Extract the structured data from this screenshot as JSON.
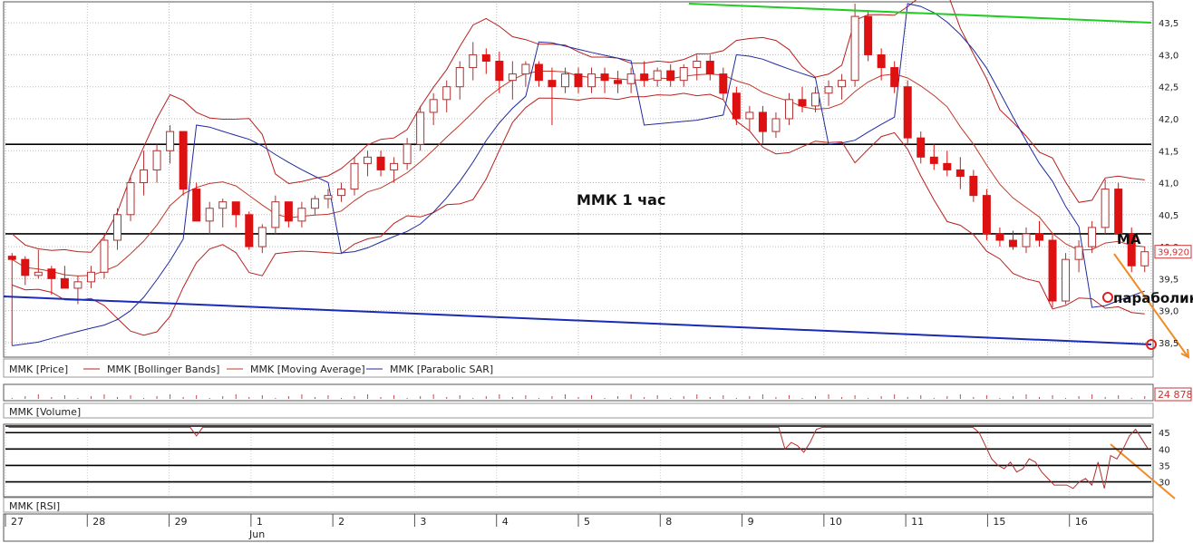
{
  "chart_data": [
    {
      "type": "candlestick",
      "title": "ММК   1 час",
      "panel": "price",
      "y_ticks": [
        "43,5",
        "43,0",
        "42,5",
        "42,0",
        "41,5",
        "41,0",
        "40,5",
        "40,0",
        "39,5",
        "39,0",
        "38,5"
      ],
      "ylim": [
        38.3,
        43.8
      ],
      "last_price_label": "39,920",
      "last_price": 39.92,
      "annotations": {
        "ma": "MA",
        "parabolic": "параболик"
      },
      "horizontal_lines": [
        41.6,
        40.2
      ],
      "candles": [
        [
          39.85,
          39.9,
          38.45,
          39.8
        ],
        [
          39.8,
          39.85,
          39.4,
          39.55
        ],
        [
          39.55,
          39.95,
          39.5,
          39.6
        ],
        [
          39.65,
          39.7,
          39.25,
          39.5
        ],
        [
          39.5,
          39.7,
          39.35,
          39.35
        ],
        [
          39.35,
          39.55,
          39.1,
          39.45
        ],
        [
          39.45,
          39.7,
          39.35,
          39.6
        ],
        [
          39.6,
          40.2,
          39.5,
          40.1
        ],
        [
          40.1,
          40.6,
          39.95,
          40.5
        ],
        [
          40.5,
          41.1,
          40.4,
          41.0
        ],
        [
          41.0,
          41.5,
          40.8,
          41.2
        ],
        [
          41.2,
          41.6,
          41.0,
          41.5
        ],
        [
          41.5,
          41.9,
          41.3,
          41.8
        ],
        [
          41.8,
          41.7,
          40.8,
          40.9
        ],
        [
          40.9,
          41.0,
          40.4,
          40.4
        ],
        [
          40.4,
          40.7,
          40.2,
          40.6
        ],
        [
          40.6,
          40.75,
          40.3,
          40.7
        ],
        [
          40.7,
          40.65,
          40.3,
          40.5
        ],
        [
          40.5,
          40.55,
          39.95,
          40.0
        ],
        [
          40.0,
          40.35,
          39.9,
          40.3
        ],
        [
          40.3,
          40.8,
          40.2,
          40.7
        ],
        [
          40.7,
          40.7,
          40.3,
          40.4
        ],
        [
          40.4,
          40.7,
          40.3,
          40.6
        ],
        [
          40.6,
          40.8,
          40.5,
          40.75
        ],
        [
          40.75,
          40.9,
          40.6,
          40.8
        ],
        [
          40.8,
          41.0,
          40.7,
          40.9
        ],
        [
          40.9,
          41.4,
          40.8,
          41.3
        ],
        [
          41.3,
          41.5,
          41.1,
          41.4
        ],
        [
          41.4,
          41.5,
          41.1,
          41.2
        ],
        [
          41.2,
          41.4,
          41.0,
          41.3
        ],
        [
          41.3,
          41.7,
          41.2,
          41.6
        ],
        [
          41.6,
          42.2,
          41.5,
          42.1
        ],
        [
          42.1,
          42.4,
          41.9,
          42.3
        ],
        [
          42.3,
          42.6,
          42.1,
          42.5
        ],
        [
          42.5,
          42.9,
          42.3,
          42.8
        ],
        [
          42.8,
          43.2,
          42.6,
          43.0
        ],
        [
          43.0,
          43.1,
          42.7,
          42.9
        ],
        [
          42.9,
          43.05,
          42.4,
          42.6
        ],
        [
          42.6,
          42.9,
          42.3,
          42.7
        ],
        [
          42.7,
          42.9,
          42.5,
          42.85
        ],
        [
          42.85,
          42.9,
          42.5,
          42.6
        ],
        [
          42.6,
          42.8,
          41.9,
          42.5
        ],
        [
          42.5,
          42.8,
          42.4,
          42.7
        ],
        [
          42.7,
          42.8,
          42.4,
          42.5
        ],
        [
          42.5,
          42.8,
          42.4,
          42.7
        ],
        [
          42.7,
          42.8,
          42.4,
          42.6
        ],
        [
          42.6,
          42.75,
          42.4,
          42.55
        ],
        [
          42.55,
          42.8,
          42.4,
          42.7
        ],
        [
          42.7,
          42.9,
          42.5,
          42.6
        ],
        [
          42.6,
          42.8,
          42.5,
          42.75
        ],
        [
          42.75,
          42.85,
          42.5,
          42.6
        ],
        [
          42.6,
          42.85,
          42.5,
          42.8
        ],
        [
          42.8,
          43.0,
          42.6,
          42.9
        ],
        [
          42.9,
          43.0,
          42.6,
          42.7
        ],
        [
          42.7,
          42.8,
          42.3,
          42.4
        ],
        [
          42.4,
          42.5,
          41.9,
          42.0
        ],
        [
          42.0,
          42.2,
          41.8,
          42.1
        ],
        [
          42.1,
          42.2,
          41.6,
          41.8
        ],
        [
          41.8,
          42.1,
          41.7,
          42.0
        ],
        [
          42.0,
          42.4,
          41.9,
          42.3
        ],
        [
          42.3,
          42.5,
          42.1,
          42.2
        ],
        [
          42.2,
          42.5,
          42.1,
          42.4
        ],
        [
          42.4,
          42.6,
          42.2,
          42.5
        ],
        [
          42.5,
          42.7,
          42.3,
          42.6
        ],
        [
          42.6,
          43.8,
          42.5,
          43.6
        ],
        [
          43.6,
          43.7,
          42.9,
          43.0
        ],
        [
          43.0,
          43.1,
          42.6,
          42.8
        ],
        [
          42.8,
          42.9,
          42.4,
          42.5
        ],
        [
          42.5,
          42.6,
          41.6,
          41.7
        ],
        [
          41.7,
          41.8,
          41.3,
          41.4
        ],
        [
          41.4,
          41.6,
          41.2,
          41.3
        ],
        [
          41.3,
          41.5,
          41.1,
          41.2
        ],
        [
          41.2,
          41.4,
          40.9,
          41.1
        ],
        [
          41.1,
          41.2,
          40.7,
          40.8
        ],
        [
          40.8,
          40.9,
          40.1,
          40.2
        ],
        [
          40.2,
          40.3,
          40.0,
          40.1
        ],
        [
          40.1,
          40.25,
          39.95,
          40.0
        ],
        [
          40.0,
          40.3,
          39.9,
          40.2
        ],
        [
          40.2,
          40.4,
          40.0,
          40.1
        ],
        [
          40.1,
          40.2,
          39.05,
          39.15
        ],
        [
          39.15,
          39.9,
          39.1,
          39.8
        ],
        [
          39.8,
          40.1,
          39.6,
          40.0
        ],
        [
          40.0,
          40.4,
          39.9,
          40.3
        ],
        [
          40.3,
          41.05,
          40.2,
          40.9
        ],
        [
          40.9,
          41.0,
          40.1,
          40.2
        ],
        [
          40.2,
          40.3,
          39.6,
          39.7
        ],
        [
          39.7,
          40.0,
          39.6,
          39.92
        ]
      ],
      "legend": [
        "MMK [Price]",
        "MMK [Bollinger Bands]",
        "MMK [Moving Average]",
        "MMK [Parabolic SAR]"
      ],
      "colors": {
        "candle": "#dd1111",
        "bollinger": "#b82020",
        "ma": "#c0392b",
        "sar": "#1f2a9e",
        "trend_top": "#22cc22",
        "trend_bottom": "#1a2bb5",
        "forecast": "#f08a24"
      }
    },
    {
      "type": "bar",
      "panel": "volume",
      "label": "MMK [Volume]",
      "last_value_label": "24 878"
    },
    {
      "type": "line",
      "panel": "rsi",
      "label": "MMK [RSI]",
      "y_ticks": [
        "45",
        "40",
        "35",
        "30"
      ],
      "ylim": [
        26,
        47
      ],
      "values": [
        47,
        47,
        47,
        47,
        47,
        47,
        47,
        47,
        47,
        47,
        47,
        47,
        47,
        47,
        47,
        47,
        47,
        47,
        47,
        47,
        47,
        47,
        47,
        47,
        47,
        47,
        47,
        47,
        47,
        47,
        44,
        47,
        47,
        47,
        47,
        47,
        47,
        47,
        47,
        47,
        47,
        47,
        47,
        47,
        47,
        47,
        47,
        47,
        47,
        47,
        47,
        47,
        47,
        47,
        47,
        47,
        47,
        47,
        47,
        47,
        47,
        47,
        47,
        47,
        47,
        47,
        47,
        47,
        47,
        47,
        47,
        47,
        47,
        47,
        47,
        47,
        47,
        47,
        47,
        47,
        47,
        47,
        47,
        47,
        47,
        47,
        47,
        47,
        47,
        47,
        47,
        47,
        47,
        47,
        47,
        47,
        47,
        47,
        47,
        47,
        47,
        47,
        47,
        47,
        47,
        47,
        47,
        47,
        47,
        47,
        47,
        47,
        47,
        47,
        47,
        47,
        47,
        47,
        47,
        47,
        47,
        47,
        47,
        47,
        40,
        42,
        41,
        39,
        42,
        46,
        47,
        47,
        47,
        47,
        47,
        47,
        47,
        47,
        47,
        47,
        47,
        47,
        47,
        47,
        47,
        47,
        47,
        47,
        47,
        47,
        47,
        47,
        47,
        47,
        47,
        45,
        41,
        37,
        35,
        34,
        36,
        33,
        34,
        37,
        36,
        33,
        31,
        29,
        29,
        29,
        28,
        30,
        31,
        29,
        36,
        28,
        38,
        37,
        40,
        44,
        46,
        43,
        40
      ]
    }
  ],
  "x_axis": {
    "labels": [
      "27",
      "28",
      "29",
      "1",
      "2",
      "3",
      "4",
      "5",
      "8",
      "9",
      "10",
      "11",
      "15",
      "16"
    ],
    "month_label": "Jun"
  }
}
